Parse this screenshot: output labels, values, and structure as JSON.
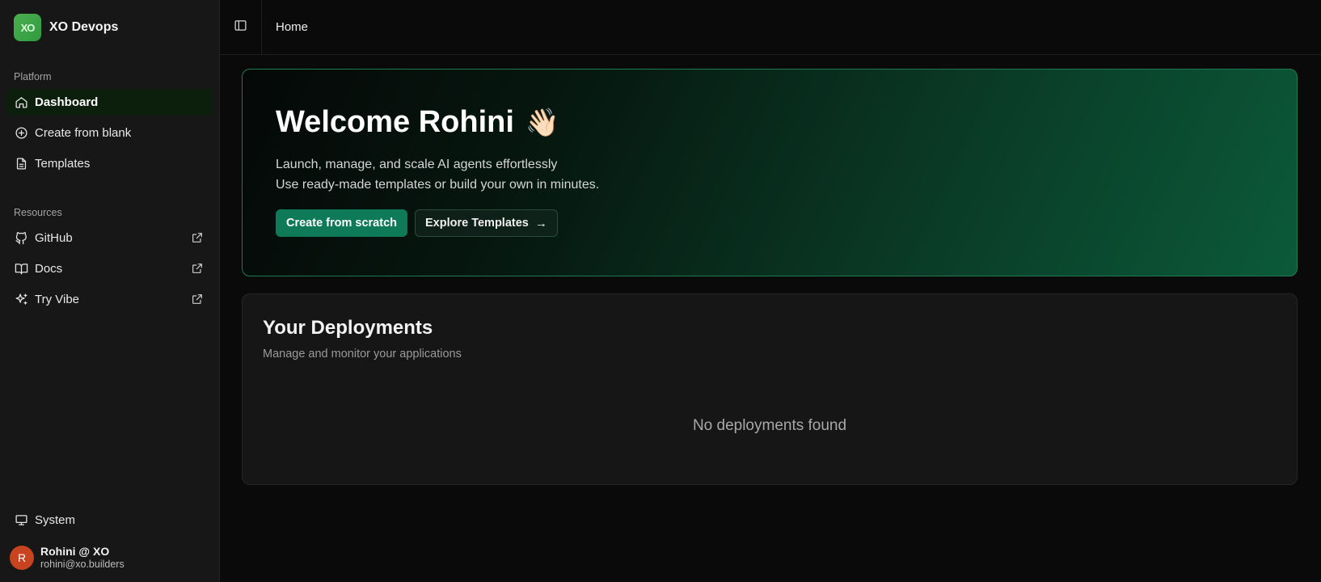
{
  "brand": {
    "name": "XO Devops",
    "logo_text": "XO"
  },
  "sidebar": {
    "platform_label": "Platform",
    "platform_items": [
      {
        "label": "Dashboard",
        "icon": "home-icon",
        "active": true
      },
      {
        "label": "Create from blank",
        "icon": "plus-circle-icon"
      },
      {
        "label": "Templates",
        "icon": "file-text-icon"
      }
    ],
    "resources_label": "Resources",
    "resource_items": [
      {
        "label": "GitHub",
        "icon": "github-icon",
        "external": true
      },
      {
        "label": "Docs",
        "icon": "book-open-icon",
        "external": true
      },
      {
        "label": "Try Vibe",
        "icon": "sparkles-icon",
        "external": true
      }
    ],
    "system_label": "System",
    "user": {
      "initial": "R",
      "name": "Rohini @ XO",
      "email": "rohini@xo.builders"
    }
  },
  "header": {
    "breadcrumb": "Home"
  },
  "hero": {
    "title": "Welcome Rohini",
    "emoji": "👋🏻",
    "line1": "Launch, manage, and scale AI agents effortlessly",
    "line2": "Use ready-made templates or build your own in minutes.",
    "primary_button": "Create from scratch",
    "secondary_button": "Explore Templates",
    "secondary_arrow": "→"
  },
  "deployments": {
    "title": "Your Deployments",
    "subtitle": "Manage and monitor your applications",
    "empty_text": "No deployments found"
  },
  "colors": {
    "accent": "#0f7a58",
    "active_nav_bg": "#0c1f0c",
    "avatar_bg": "#c8431f",
    "logo_bg": "#4caf50"
  }
}
